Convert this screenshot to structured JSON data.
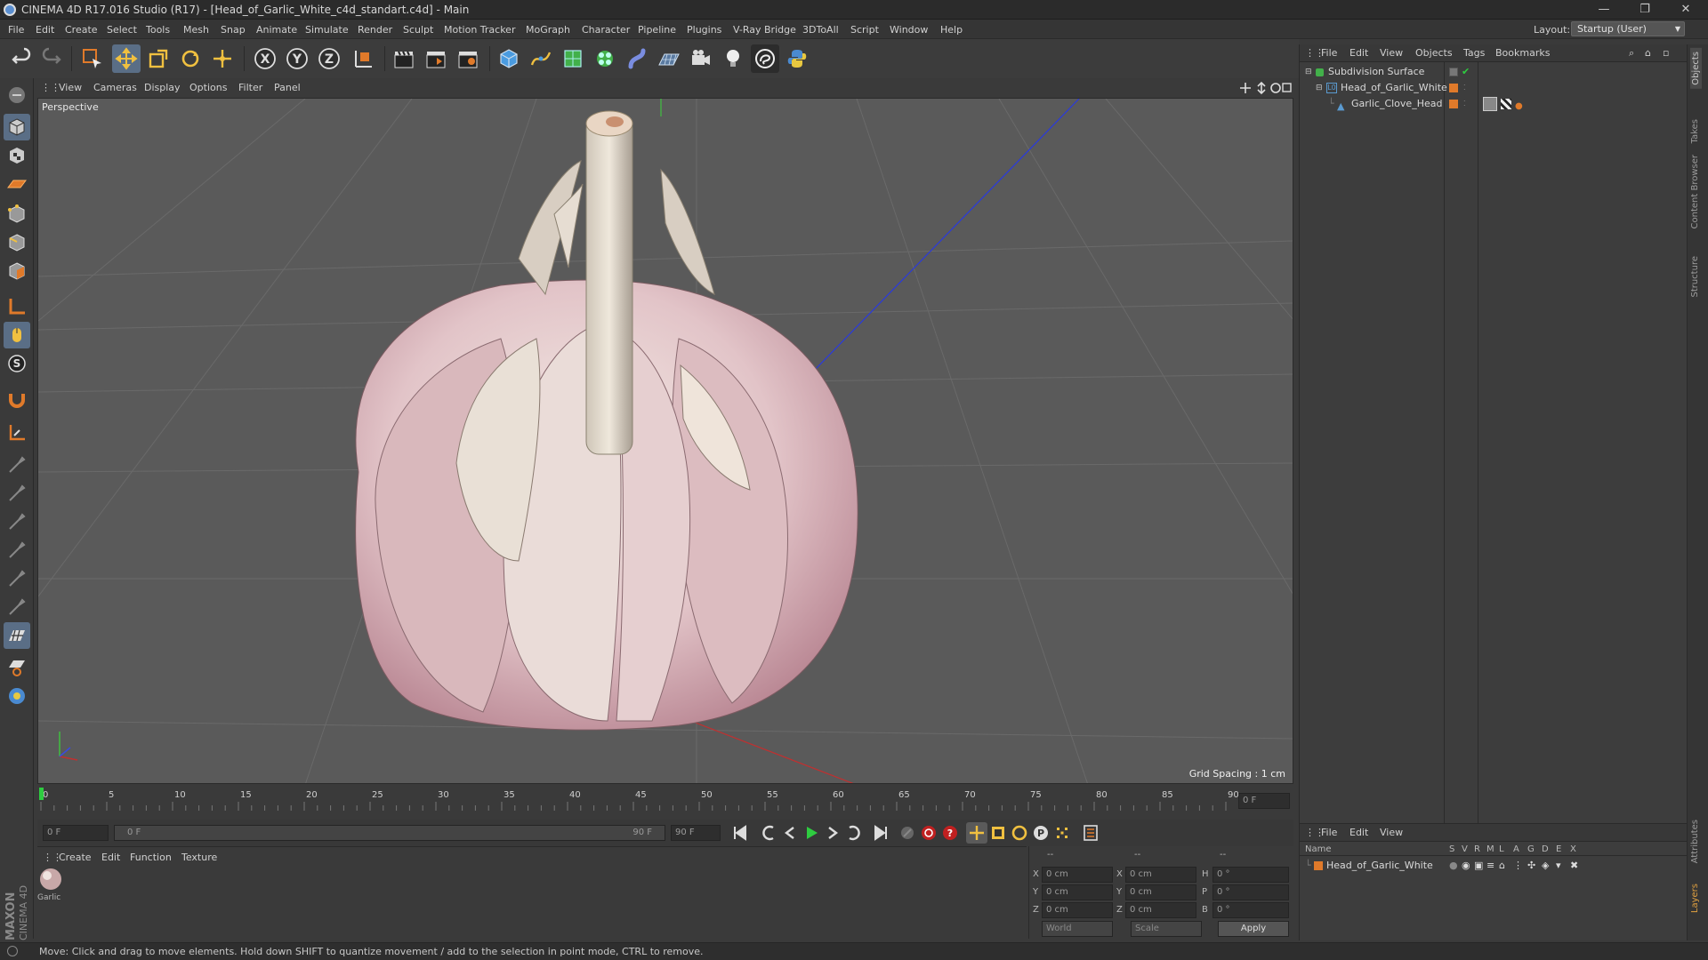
{
  "window": {
    "title": "CINEMA 4D R17.016 Studio (R17) - [Head_of_Garlic_White_c4d_standart.c4d] - Main",
    "controls": [
      "—",
      "❐",
      "✕"
    ]
  },
  "menubar": {
    "items": [
      "File",
      "Edit",
      "Create",
      "Select",
      "Tools",
      "Mesh",
      "Snap",
      "Animate",
      "Simulate",
      "Render",
      "Sculpt",
      "Motion Tracker",
      "MoGraph",
      "Character",
      "Pipeline",
      "Plugins",
      "V-Ray Bridge",
      "3DToAll",
      "Script",
      "Window",
      "Help"
    ],
    "layout_label": "Layout:",
    "layout_value": "Startup (User)"
  },
  "viewport": {
    "menu": [
      "View",
      "Cameras",
      "Display",
      "Options",
      "Filter",
      "Panel"
    ],
    "label": "Perspective",
    "grid_spacing": "Grid Spacing : 1 cm"
  },
  "timeline": {
    "ticks": [
      "0",
      "5",
      "10",
      "15",
      "20",
      "25",
      "30",
      "35",
      "40",
      "45",
      "50",
      "55",
      "60",
      "65",
      "70",
      "75",
      "80",
      "85",
      "90"
    ],
    "current_frame": "0 F",
    "start_field": "0 F",
    "range_start": "0 F",
    "range_end": "90 F",
    "end_field": "90 F"
  },
  "material_panel": {
    "menu": [
      "Create",
      "Edit",
      "Function",
      "Texture"
    ],
    "material_name": "Garlic"
  },
  "coords": {
    "headers": [
      "--",
      "--",
      "--"
    ],
    "rows": [
      {
        "axis": "X",
        "pos": "0 cm",
        "axis2": "X",
        "size": "0 cm",
        "rot_axis": "H",
        "rot": "0 °"
      },
      {
        "axis": "Y",
        "pos": "0 cm",
        "axis2": "Y",
        "size": "0 cm",
        "rot_axis": "P",
        "rot": "0 °"
      },
      {
        "axis": "Z",
        "pos": "0 cm",
        "axis2": "Z",
        "size": "0 cm",
        "rot_axis": "B",
        "rot": "0 °"
      }
    ],
    "space_select": "World",
    "mode_select": "Scale",
    "apply_label": "Apply"
  },
  "objects_panel": {
    "menu": [
      "File",
      "Edit",
      "View",
      "Objects",
      "Tags",
      "Bookmarks"
    ],
    "objects": [
      {
        "name": "Subdivision Surface",
        "color": "#6fbf52"
      },
      {
        "name": "Head_of_Garlic_White",
        "color": "#d9d9d9"
      },
      {
        "name": "Garlic_Clove_Head",
        "color": "#d9d9d9"
      }
    ]
  },
  "layers_panel": {
    "menu": [
      "File",
      "Edit",
      "View"
    ],
    "columns": [
      "Name",
      "S",
      "V",
      "R",
      "M",
      "L",
      "A",
      "G",
      "D",
      "E",
      "X"
    ],
    "rows": [
      {
        "name": "Head_of_Garlic_White",
        "color": "#e07a2a"
      }
    ]
  },
  "side_tabs": [
    "Objects",
    "Takes",
    "Content Browser",
    "Structure",
    "Attributes",
    "Layers"
  ],
  "status": "Move: Click and drag to move elements. Hold down SHIFT to quantize movement / add to the selection in point mode, CTRL to remove.",
  "branding": {
    "logo_text": "MAXON CINEMA 4D"
  },
  "colors": {
    "accent_orange": "#e07a2a",
    "accent_blue": "#4a9be0",
    "active_green": "#2ecc40"
  }
}
